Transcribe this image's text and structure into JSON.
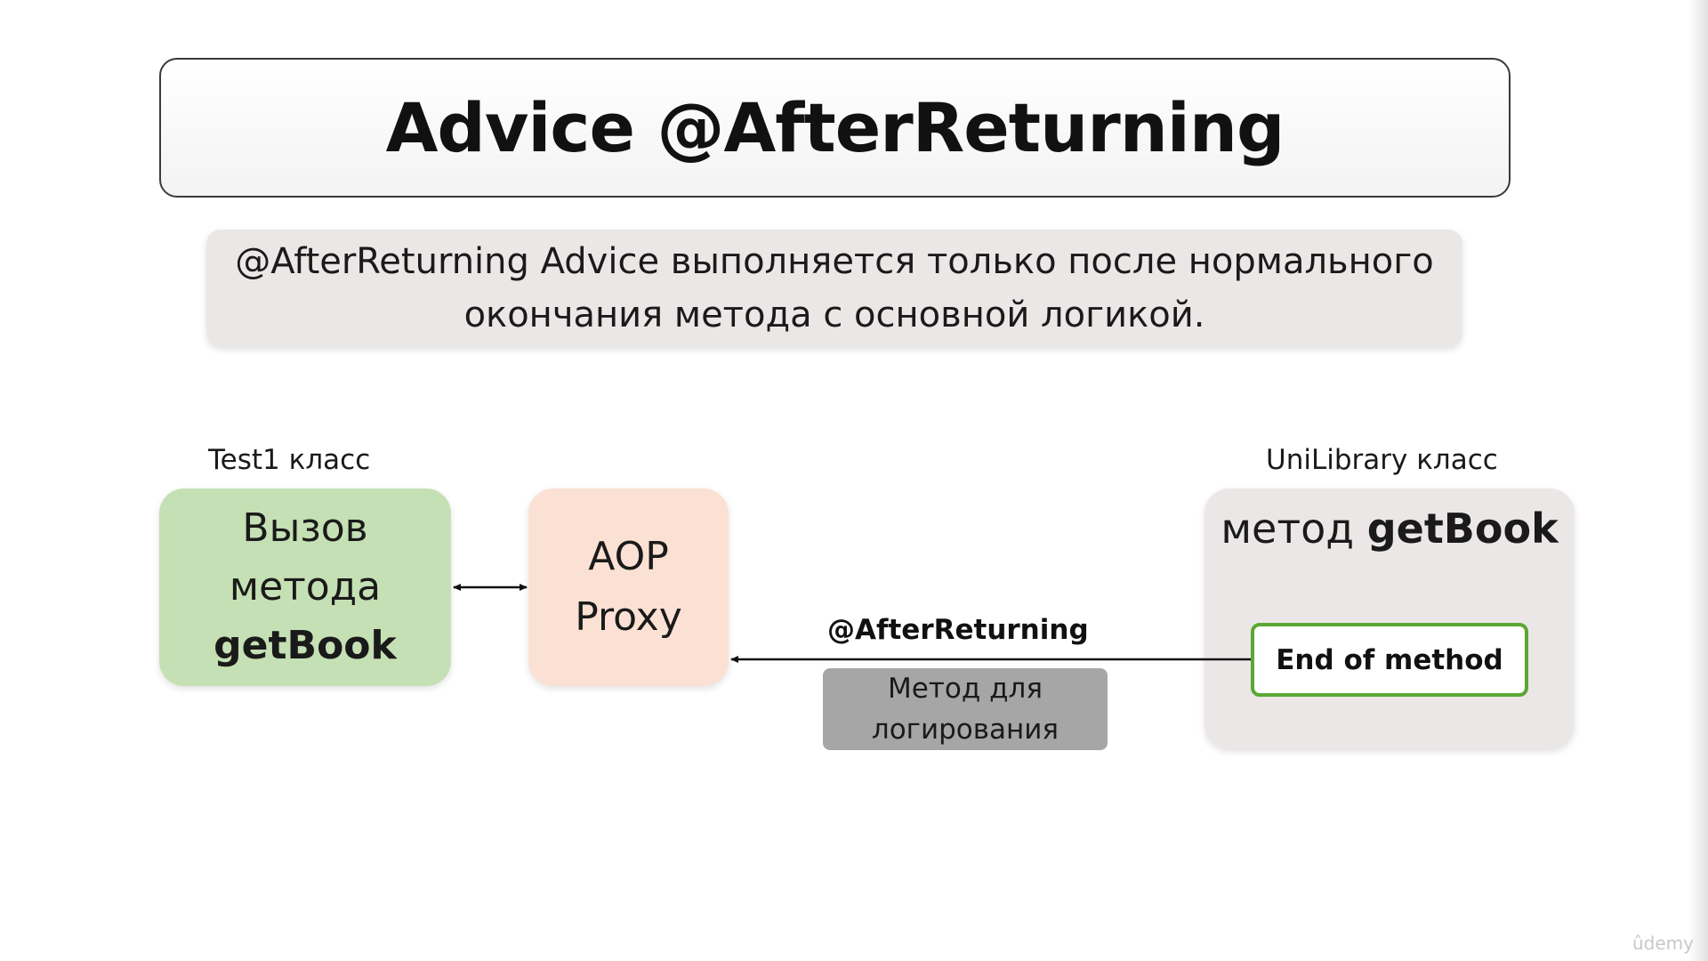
{
  "slide": {
    "title": "Advice @AfterReturning",
    "description": "@AfterReturning Advice выполняется только после нормального окончания метода с основной логикой."
  },
  "diagram": {
    "caller": {
      "class_label": "Test1 класс",
      "lines": [
        "Вызов",
        "метода",
        "getBook"
      ]
    },
    "proxy": {
      "lines": [
        "AOP",
        "Proxy"
      ]
    },
    "target": {
      "class_label": "UniLibrary класс",
      "method_prefix": "метод",
      "method_name": "getBook",
      "end_label": "End of method"
    },
    "advice": {
      "annotation": "@AfterReturning",
      "logger_label": "Метод для логирования"
    }
  },
  "watermark": "ûdemy",
  "colors": {
    "caller_fill": "#c5e0b4",
    "proxy_fill": "#fbe1d4",
    "target_fill": "#ece7e7",
    "end_border": "#5aa832",
    "logger_fill": "#a6a6a6"
  }
}
